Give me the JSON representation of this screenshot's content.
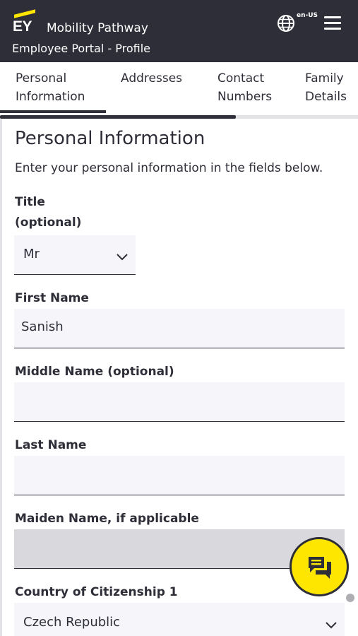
{
  "header": {
    "logo_text": "EY",
    "app_name": "Mobility Pathway",
    "subtitle": "Employee Portal - Profile",
    "locale": "en-US",
    "icons": [
      "globe-icon",
      "hamburger-menu-icon"
    ],
    "colors": {
      "header_bg": "#2e2e38",
      "brand_yellow": "#ffe600"
    }
  },
  "tabs": [
    {
      "line1": "Personal",
      "line2": "Information",
      "active": true
    },
    {
      "line1": "Addresses",
      "line2": "",
      "active": false
    },
    {
      "line1": "Contact",
      "line2": "Numbers",
      "active": false
    },
    {
      "line1": "Family",
      "line2": "Details",
      "active": false
    }
  ],
  "section": {
    "title": "Personal Information",
    "intro": "Enter your personal information in the fields below."
  },
  "form": {
    "title_field": {
      "label_line1": "Title",
      "label_line2": "(optional)",
      "value": "Mr"
    },
    "first_name": {
      "label": "First Name",
      "value": "Sanish"
    },
    "middle_name": {
      "label": "Middle Name (optional)",
      "value": ""
    },
    "last_name": {
      "label": "Last Name",
      "value": ""
    },
    "maiden_name": {
      "label": "Maiden Name, if applicable",
      "value": "",
      "disabled": true
    },
    "citizenship_1": {
      "label": "Country of Citizenship 1",
      "value": "Czech Republic"
    }
  },
  "chat": {
    "icon": "chat-bubbles-icon"
  }
}
